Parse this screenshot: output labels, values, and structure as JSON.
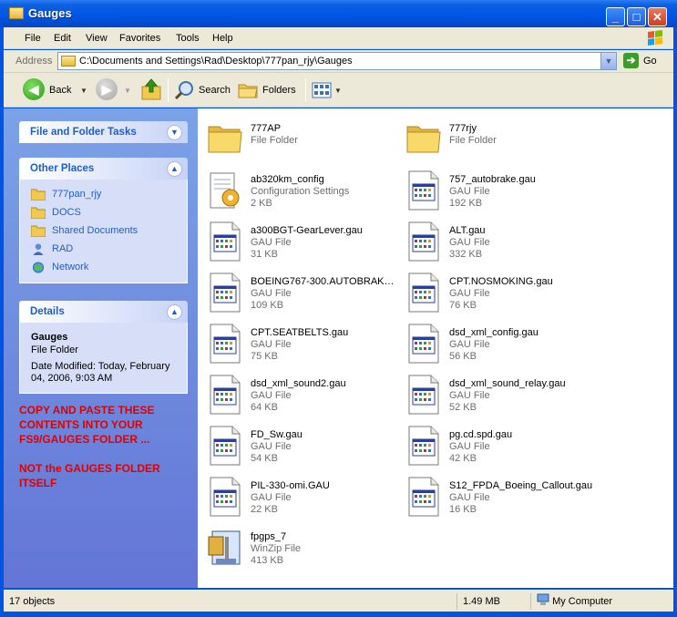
{
  "window": {
    "title": "Gauges",
    "buttons": {
      "minimize": "_",
      "maximize": "□",
      "close": "✕"
    }
  },
  "menu": [
    "File",
    "Edit",
    "View",
    "Favorites",
    "Tools",
    "Help"
  ],
  "address": {
    "label": "Address",
    "path": "C:\\Documents and Settings\\Rad\\Desktop\\777pan_rjy\\Gauges",
    "go": "Go"
  },
  "toolbar": {
    "back": "Back",
    "search": "Search",
    "folders": "Folders"
  },
  "left_pane": {
    "file_folder_tasks": {
      "title": "File and Folder Tasks"
    },
    "other_places": {
      "title": "Other Places",
      "items": [
        {
          "label": "777pan_rjy",
          "icon": "folder-icon"
        },
        {
          "label": "DOCS",
          "icon": "folder-icon"
        },
        {
          "label": "Shared Documents",
          "icon": "folder-icon"
        },
        {
          "label": "RAD",
          "icon": "user-icon"
        },
        {
          "label": "Network",
          "icon": "network-icon"
        }
      ]
    },
    "details": {
      "title": "Details",
      "name": "Gauges",
      "type": "File Folder",
      "date_modified": "Date Modified: Today, February 04, 2006, 9:03 AM"
    },
    "note_1": "COPY AND PASTE THESE CONTENTS INTO YOUR FS9/GAUGES FOLDER ...",
    "note_2": "NOT the GAUGES FOLDER ITSELF"
  },
  "files": [
    {
      "name": "777AP",
      "type": "File Folder",
      "size": "",
      "icon": "folder"
    },
    {
      "name": "777rjy",
      "type": "File Folder",
      "size": "",
      "icon": "folder"
    },
    {
      "name": "ab320km_config",
      "type": "Configuration Settings",
      "size": "2 KB",
      "icon": "config"
    },
    {
      "name": "757_autobrake.gau",
      "type": "GAU File",
      "size": "192 KB",
      "icon": "gau"
    },
    {
      "name": "a300BGT-GearLever.gau",
      "type": "GAU File",
      "size": "31 KB",
      "icon": "gau"
    },
    {
      "name": "ALT.gau",
      "type": "GAU File",
      "size": "332 KB",
      "icon": "gau"
    },
    {
      "name": "BOEING767-300.AUTOBRAKE....",
      "type": "GAU File",
      "size": "109 KB",
      "icon": "gau"
    },
    {
      "name": "CPT.NOSMOKING.gau",
      "type": "GAU File",
      "size": "76 KB",
      "icon": "gau"
    },
    {
      "name": "CPT.SEATBELTS.gau",
      "type": "GAU File",
      "size": "75 KB",
      "icon": "gau"
    },
    {
      "name": "dsd_xml_config.gau",
      "type": "GAU File",
      "size": "56 KB",
      "icon": "gau"
    },
    {
      "name": "dsd_xml_sound2.gau",
      "type": "GAU File",
      "size": "64 KB",
      "icon": "gau"
    },
    {
      "name": "dsd_xml_sound_relay.gau",
      "type": "GAU File",
      "size": "52 KB",
      "icon": "gau"
    },
    {
      "name": "FD_Sw.gau",
      "type": "GAU File",
      "size": "54 KB",
      "icon": "gau"
    },
    {
      "name": "pg.cd.spd.gau",
      "type": "GAU File",
      "size": "42 KB",
      "icon": "gau"
    },
    {
      "name": "PIL-330-omi.GAU",
      "type": "GAU File",
      "size": "22 KB",
      "icon": "gau"
    },
    {
      "name": "S12_FPDA_Boeing_Callout.gau",
      "type": "GAU File",
      "size": "16 KB",
      "icon": "gau"
    },
    {
      "name": "fpgps_7",
      "type": "WinZip File",
      "size": "413 KB",
      "icon": "zip"
    }
  ],
  "status": {
    "objects": "17 objects",
    "size": "1.49 MB",
    "location": "My Computer"
  }
}
